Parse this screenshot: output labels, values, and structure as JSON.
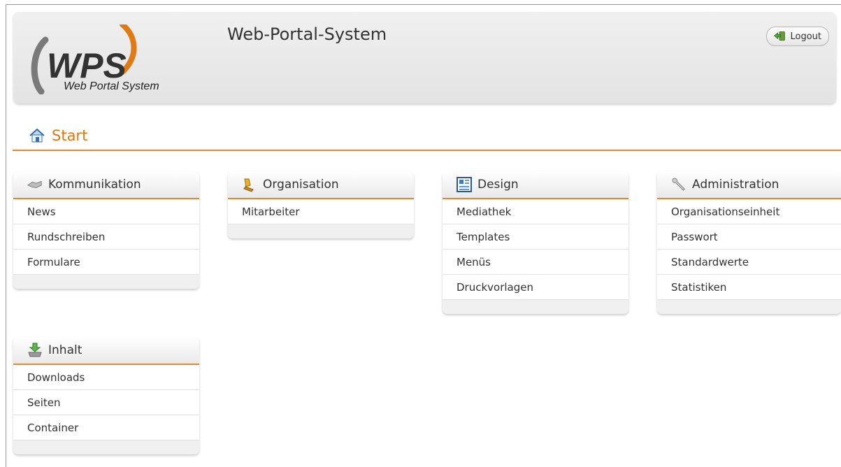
{
  "header": {
    "logo_text": "WPS",
    "logo_subtitle": "Web Portal System",
    "title": "Web-Portal-System",
    "logout_label": "Logout"
  },
  "breadcrumb": {
    "label": "Start"
  },
  "panels": [
    {
      "title": "Kommunikation",
      "icon": "handshake-icon",
      "items": [
        "News",
        "Rundschreiben",
        "Formulare"
      ]
    },
    {
      "title": "Organisation",
      "icon": "stamp-icon",
      "items": [
        "Mitarbeiter"
      ]
    },
    {
      "title": "Design",
      "icon": "layout-icon",
      "items": [
        "Mediathek",
        "Templates",
        "Menüs",
        "Druckvorlagen"
      ]
    },
    {
      "title": "Administration",
      "icon": "wrench-icon",
      "items": [
        "Organisationseinheit",
        "Passwort",
        "Standardwerte",
        "Statistiken"
      ]
    },
    {
      "title": "Inhalt",
      "icon": "download-tray-icon",
      "items": [
        "Downloads",
        "Seiten",
        "Container"
      ]
    }
  ],
  "colors": {
    "accent": "#e08a2c",
    "breadcrumb_text": "#e07a15"
  }
}
